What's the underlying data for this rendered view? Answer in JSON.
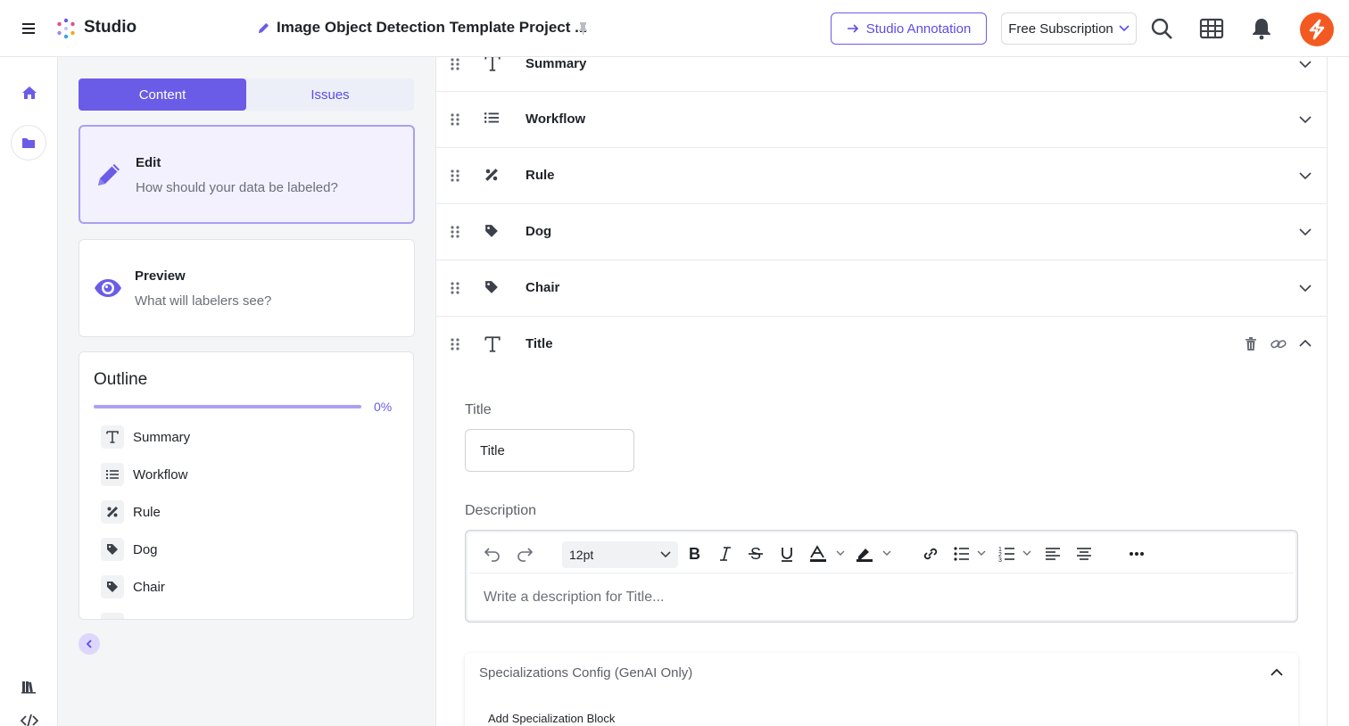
{
  "app": {
    "brand": "Studio",
    "project_title": "Image Object Detection Template Project ..."
  },
  "header": {
    "annotation_button": "Studio Annotation",
    "subscription": "Free Subscription",
    "avatar_color": "#f25a22",
    "accent": "#6b5ce7"
  },
  "tabs": [
    {
      "label": "Content",
      "active": true
    },
    {
      "label": "Issues",
      "active": false
    }
  ],
  "cards": {
    "edit": {
      "title": "Edit",
      "subtitle": "How should your data be labeled?"
    },
    "preview": {
      "title": "Preview",
      "subtitle": "What will labelers see?"
    }
  },
  "outline": {
    "heading": "Outline",
    "progress_label": "0%",
    "progress_value": 0,
    "items": [
      {
        "label": "Summary",
        "icon": "text-icon"
      },
      {
        "label": "Workflow",
        "icon": "list-icon"
      },
      {
        "label": "Rule",
        "icon": "rule-icon"
      },
      {
        "label": "Dog",
        "icon": "tag-icon"
      },
      {
        "label": "Chair",
        "icon": "tag-icon"
      }
    ]
  },
  "sections": [
    {
      "label": "Summary",
      "icon": "text-icon",
      "expanded": false
    },
    {
      "label": "Workflow",
      "icon": "list-icon",
      "expanded": false
    },
    {
      "label": "Rule",
      "icon": "rule-icon",
      "expanded": false
    },
    {
      "label": "Dog",
      "icon": "tag-icon",
      "expanded": false
    },
    {
      "label": "Chair",
      "icon": "tag-icon",
      "expanded": false
    },
    {
      "label": "Title",
      "icon": "text-icon",
      "expanded": true
    }
  ],
  "detail": {
    "title_label": "Title",
    "title_value": "Title",
    "description_label": "Description",
    "font_size": "12pt",
    "description_placeholder": "Write a description for Title...",
    "spec_title": "Specializations Config (GenAI Only)",
    "spec_add": "Add Specialization Block"
  }
}
